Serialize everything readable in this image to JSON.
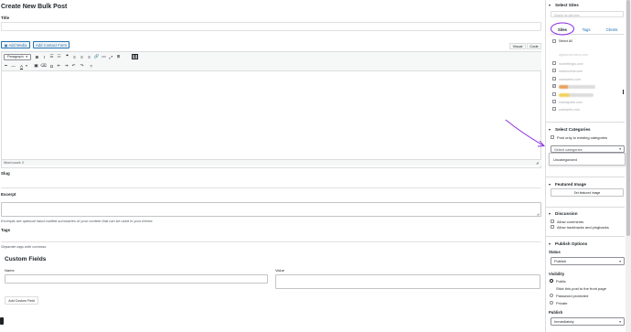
{
  "page": {
    "title": "Create New Bulk Post"
  },
  "main": {
    "title_label": "Title",
    "add_media": "Add Media",
    "add_contact_form": "Add Contact Form",
    "tab_visual": "Visual",
    "tab_code": "Code",
    "format_select": "Paragraph",
    "word_count": "Word count: 0",
    "slug_label": "Slug",
    "excerpt_label": "Excerpt",
    "excerpt_help": "Excerpts are optional hand-crafted summaries of your content that can be used in your theme.",
    "tags_label": "Tags",
    "tags_help": "Separate tags with commas",
    "custom_fields_heading": "Custom Fields",
    "cf_name_label": "Name",
    "cf_value_label": "Value",
    "add_custom_field": "Add Custom Field"
  },
  "select_sites": {
    "title": "Select Sites",
    "search_placeholder": "Search for site here",
    "tabs": [
      "Sites",
      "Tags",
      "Clients"
    ],
    "select_all": "Select All",
    "sites": [
      {
        "name": "hometheglo.com",
        "checked": false
      },
      {
        "name": "maneuvertv.com",
        "checked": false
      },
      {
        "name": "mainwebs.com",
        "checked": false
      },
      {
        "name": "aglanzcorecms.com",
        "checked": true
      },
      {
        "name": "mainwpdemo.test",
        "checked": false
      },
      {
        "name": "mainwpsite.com",
        "checked": false
      },
      {
        "name": "mainwebi.com",
        "checked": false
      }
    ]
  },
  "select_categories": {
    "title": "Select Categories",
    "post_only_existing": "Post only to existing categories",
    "select_placeholder": "Select categories",
    "dropdown_option": "Uncategorized"
  },
  "featured_image": {
    "title": "Featured Image",
    "button": "Set featured image"
  },
  "discussion": {
    "title": "Discussion",
    "allow_comments": "Allow comments",
    "allow_trackbacks": "Allow trackbacks and pingbacks"
  },
  "publish_options": {
    "title": "Publish Options",
    "status_label": "Status",
    "status_value": "Publish",
    "visibility_label": "Visibility",
    "visibility_options": [
      "Public",
      "Stick this post to the front page",
      "Password protected",
      "Private"
    ],
    "publish_label": "Publish",
    "publish_value": "Immediately"
  },
  "colors": {
    "accent": "#2271b1",
    "annotation": "#8a2be2",
    "checkbox_checked": "#1d2327"
  }
}
